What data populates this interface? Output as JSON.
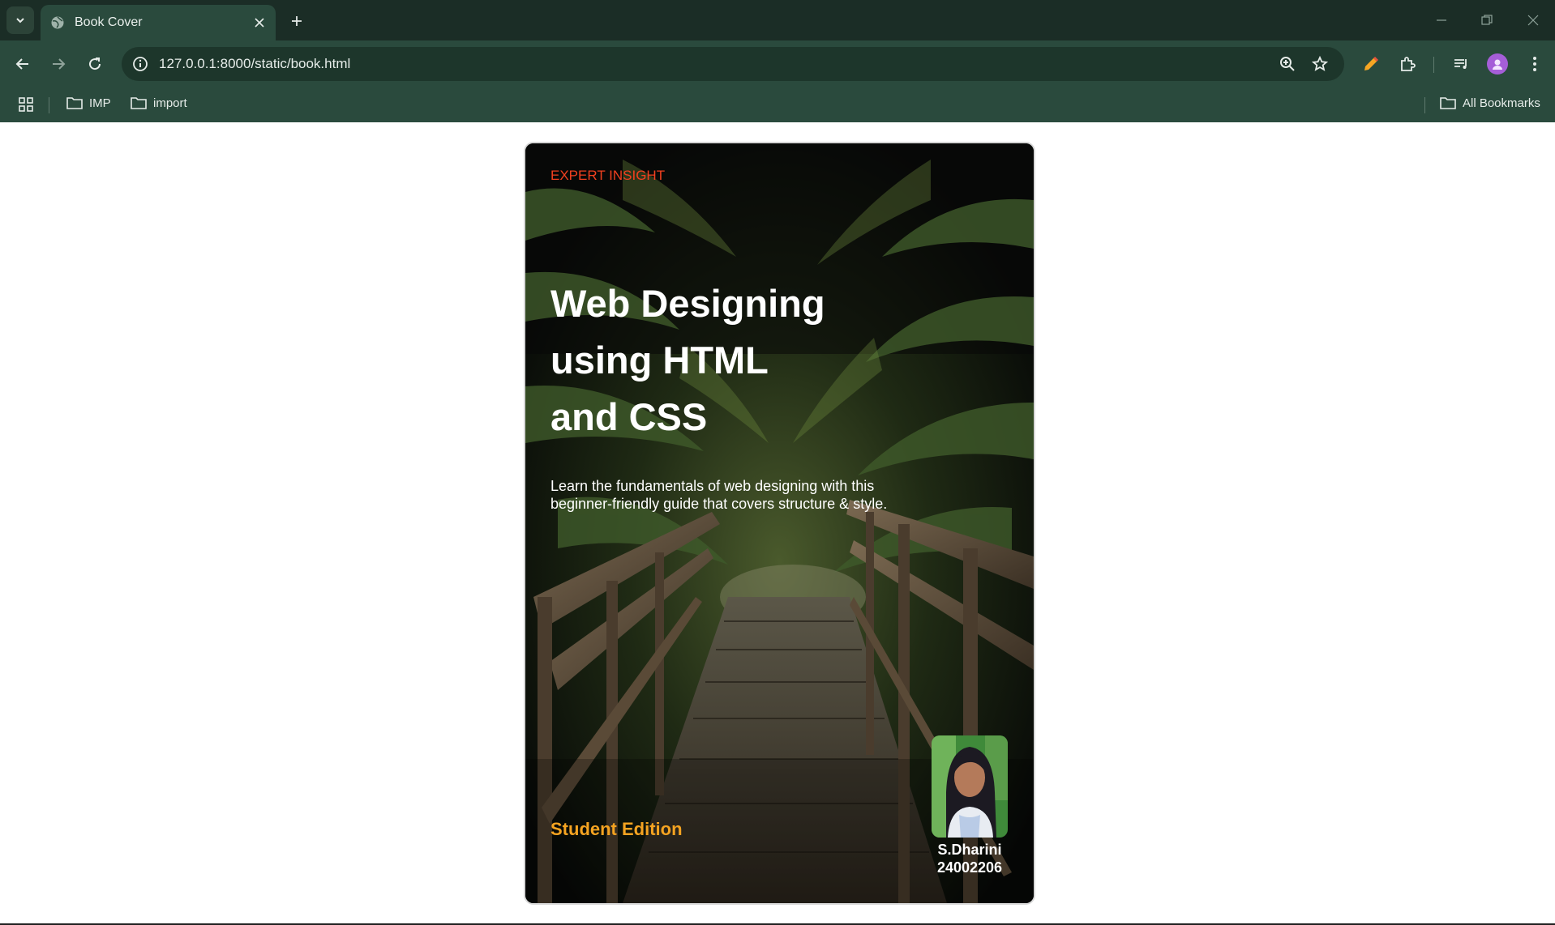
{
  "browser": {
    "tab_title": "Book Cover",
    "url": "127.0.0.1:8000/static/book.html",
    "bookmarks": [
      {
        "label": "IMP"
      },
      {
        "label": "import"
      }
    ],
    "all_bookmarks_label": "All Bookmarks"
  },
  "cover": {
    "label_top": "EXPERT INSIGHT",
    "title_line1": "Web Designing",
    "title_line2": "using HTML",
    "title_line3": "and CSS",
    "description_line1": "Learn the fundamentals of web designing with this",
    "description_line2": "beginner-friendly guide that covers structure & style.",
    "edition": "Student Edition",
    "author_name": "S.Dharini",
    "author_id": "24002206"
  },
  "colors": {
    "accent_label": "#f0401f",
    "edition": "#f4a321",
    "chrome_bg": "#213c31"
  }
}
